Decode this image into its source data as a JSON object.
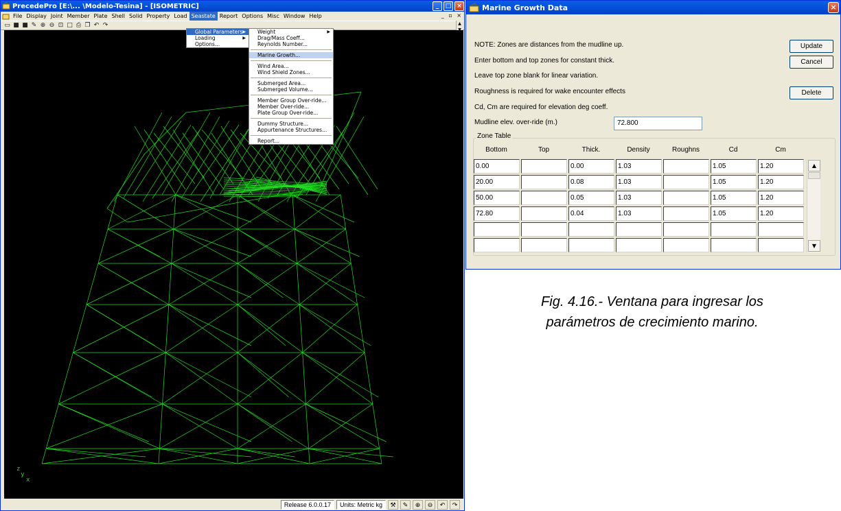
{
  "app": {
    "title": "PrecedePro   [E:\\...  \\Modelo-Tesina] - [ISOMETRIC]",
    "menus": [
      "File",
      "Display",
      "Joint",
      "Member",
      "Plate",
      "Shell",
      "Solid",
      "Property",
      "Load",
      "Seastate",
      "Report",
      "Options",
      "Misc",
      "Window",
      "Help"
    ],
    "active_menu": "Seastate",
    "seastate_menu": [
      {
        "label": "Global Parameters",
        "submenu": true
      },
      {
        "label": "Loading",
        "submenu": true
      },
      {
        "label": "Options..."
      }
    ],
    "global_params_menu": [
      {
        "label": "Weight",
        "submenu": true
      },
      {
        "label": "Drag/Mass Coeff..."
      },
      {
        "label": "Reynolds Number..."
      },
      {
        "label": "Marine Growth..."
      },
      {
        "label": "Wind Area..."
      },
      {
        "label": "Wind Shield Zones..."
      },
      {
        "label": "Submerged Area..."
      },
      {
        "label": "Submerged Volume..."
      },
      {
        "label": "Member Group Over-ride..."
      },
      {
        "label": "Member Over-ride..."
      },
      {
        "label": "Plate Group Over-ride..."
      },
      {
        "label": "Dummy Structure..."
      },
      {
        "label": "Appurtenance Structures..."
      },
      {
        "label": "Report..."
      }
    ],
    "highlighted_item": "Marine Growth...",
    "status": {
      "release": "Release 6.0.0.17",
      "units": "Units: Metric kg"
    },
    "axis": {
      "z": "z",
      "y": "y",
      "x": "x"
    },
    "wireframe_color": "#22dd22"
  },
  "dialog": {
    "title": "Marine Growth Data",
    "notes": [
      "NOTE: Zones are distances from the mudline up.",
      "Enter bottom and top zones for constant thick.",
      "Leave top zone blank for linear variation.",
      "Roughness is required for wake encounter effects",
      "Cd, Cm are required for elevation deg coeff."
    ],
    "mudline_label": "Mudline elev. over-ride (m.)",
    "mudline_value": "72.800",
    "buttons": {
      "update": "Update",
      "cancel": "Cancel",
      "delete": "Delete"
    },
    "zone_table": {
      "legend": "Zone Table",
      "headers": [
        "Bottom",
        "Top",
        "Thick.",
        "Density",
        "Roughns",
        "Cd",
        "Cm"
      ],
      "rows": [
        [
          "0.00",
          "",
          "0.00",
          "1.03",
          "",
          "1.05",
          "1.20"
        ],
        [
          "20.00",
          "",
          "0.08",
          "1.03",
          "",
          "1.05",
          "1.20"
        ],
        [
          "50.00",
          "",
          "0.05",
          "1.03",
          "",
          "1.05",
          "1.20"
        ],
        [
          "72.80",
          "",
          "0.04",
          "1.03",
          "",
          "1.05",
          "1.20"
        ],
        [
          "",
          "",
          "",
          "",
          "",
          "",
          ""
        ],
        [
          "",
          "",
          "",
          "",
          "",
          "",
          ""
        ]
      ]
    }
  },
  "caption": {
    "line1": "Fig. 4.16.- Ventana para ingresar los",
    "line2": "parámetros de crecimiento marino."
  }
}
